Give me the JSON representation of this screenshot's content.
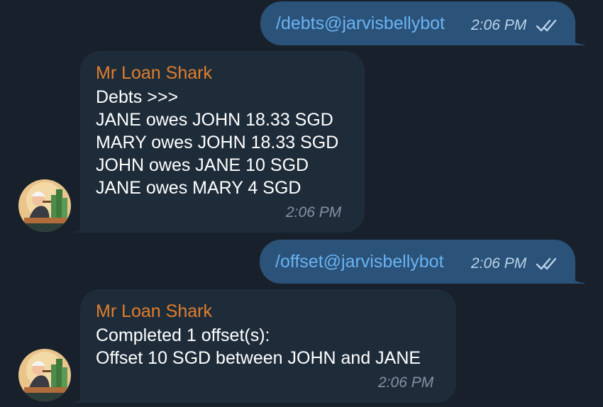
{
  "messages": [
    {
      "kind": "outgoing",
      "text": "/debts@jarvisbellybot",
      "time": "2:06 PM",
      "status_icon": "double-check-icon"
    },
    {
      "kind": "incoming",
      "sender": "Mr Loan Shark",
      "lines": [
        "Debts >>>",
        "JANE owes JOHN 18.33 SGD",
        "MARY owes JOHN 18.33 SGD",
        "JOHN owes JANE 10 SGD",
        "JANE owes MARY 4 SGD"
      ],
      "time": "2:06 PM",
      "avatar_icon": "loan-shark-avatar-icon"
    },
    {
      "kind": "outgoing",
      "text": "/offset@jarvisbellybot",
      "time": "2:06 PM",
      "status_icon": "double-check-icon"
    },
    {
      "kind": "incoming",
      "sender": "Mr Loan Shark",
      "lines": [
        "Completed 1 offset(s):",
        "Offset 10 SGD between JOHN and JANE"
      ],
      "time": "2:06 PM",
      "avatar_icon": "loan-shark-avatar-icon"
    }
  ],
  "colors": {
    "background": "#18212b",
    "outgoing_bubble": "#2b5278",
    "incoming_bubble": "#1e2c3a",
    "command_link": "#6ab3f3",
    "sender_name": "#e27d2b",
    "message_text": "#ffffff",
    "outgoing_time": "#b9d3ea",
    "incoming_time": "#8391a0"
  }
}
